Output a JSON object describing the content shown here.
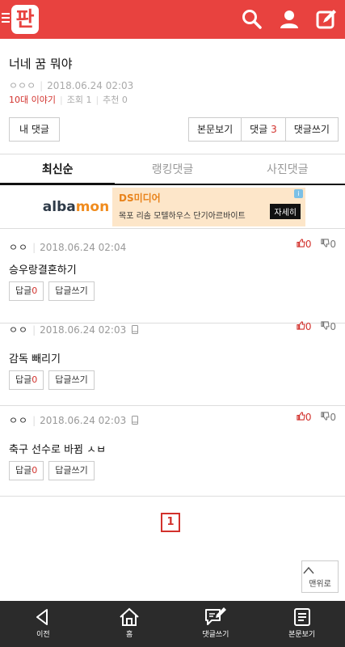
{
  "header": {
    "logo": "판",
    "icons": [
      "menu-icon",
      "search-icon",
      "user-icon",
      "write-icon"
    ]
  },
  "post": {
    "title": "너네 꿈 뭐야",
    "author": "ㅇㅇㅇ",
    "date": "2018.06.24 02:03",
    "board": "10대 이야기",
    "views": "조회 1",
    "recommends": "추천 0"
  },
  "actions": {
    "my_comments": "내 댓글",
    "view_post": "본문보기",
    "comments_label": "댓글",
    "comments_count": "3",
    "write_comment": "댓글쓰기"
  },
  "tabs": [
    {
      "label": "최신순"
    },
    {
      "label": "랭킹댓글"
    },
    {
      "label": "사진댓글"
    }
  ],
  "ad": {
    "logo_a": "alba",
    "logo_b": "mon",
    "title": "DS미디어",
    "desc": "목포 리솜 모텔하우스 단기아르바이트",
    "cta": "자세히",
    "info": "i"
  },
  "comments": [
    {
      "user": "ㅇㅇ",
      "date": "2018.06.24 02:04",
      "body": "승우랑결혼하기",
      "up": "0",
      "down": "0",
      "reply_label": "답글",
      "reply_count": "0",
      "write_reply": "답글쓰기"
    },
    {
      "user": "ㅇㅇ",
      "date": "2018.06.24 02:03",
      "body": "감독 빼리기",
      "up": "0",
      "down": "0",
      "reply_label": "답글",
      "reply_count": "0",
      "write_reply": "답글쓰기"
    },
    {
      "user": "ㅇㅇ",
      "date": "2018.06.24 02:03",
      "body": "축구 선수로 바뀜 ㅅㅂ",
      "up": "0",
      "down": "0",
      "reply_label": "답글",
      "reply_count": "0",
      "write_reply": "답글쓰기"
    }
  ],
  "pagination": {
    "current": "1"
  },
  "to_top": "맨위로",
  "bottom_nav": [
    {
      "label": "이전",
      "icon": "back-icon"
    },
    {
      "label": "홈",
      "icon": "home-icon"
    },
    {
      "label": "댓글쓰기",
      "icon": "comment-write-icon"
    },
    {
      "label": "본문보기",
      "icon": "document-icon"
    }
  ],
  "colors": {
    "brand": "#e8423f",
    "accent_red": "#d2312c",
    "bottom_bar": "#2b2b2b"
  }
}
